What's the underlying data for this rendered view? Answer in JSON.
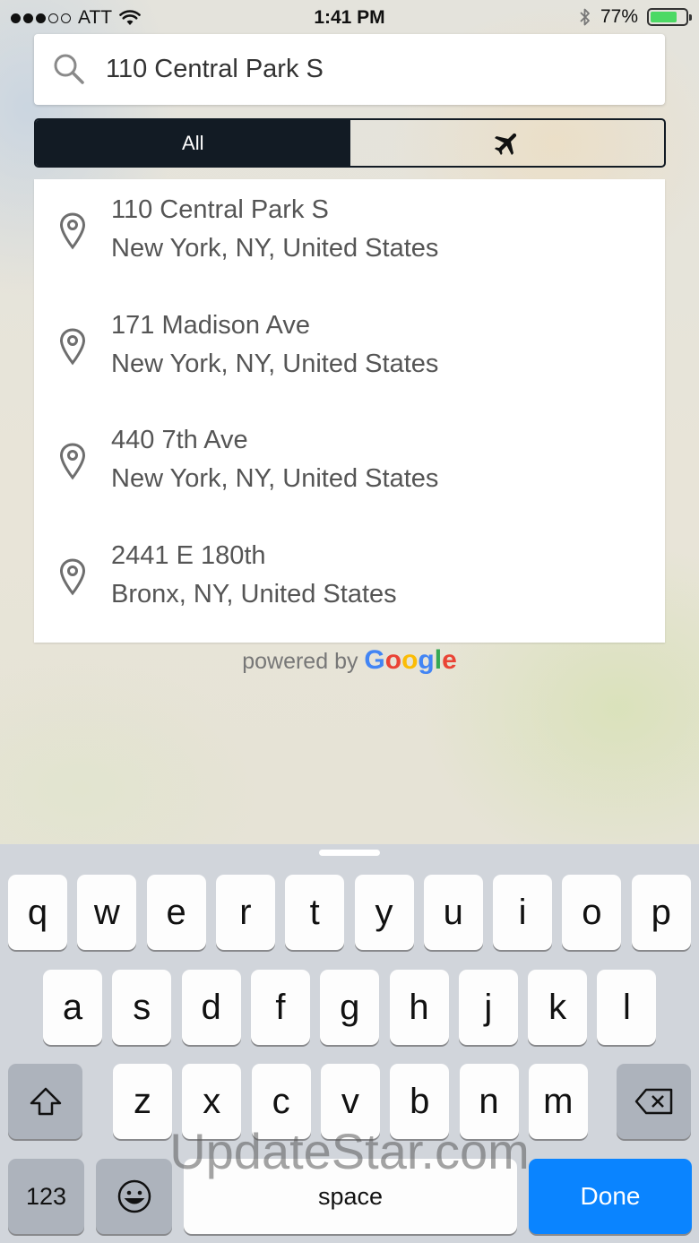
{
  "status_bar": {
    "carrier": "ATT",
    "time": "1:41 PM",
    "battery_percent": "77%",
    "battery_level": 0.77,
    "signal_dots_filled": 3,
    "signal_dots_total": 5
  },
  "search": {
    "value": "110 Central Park S"
  },
  "filter_tabs": {
    "all_label": "All",
    "airport_icon": "airplane-icon",
    "selected": "all"
  },
  "results": [
    {
      "street": "110 Central Park S",
      "locality": "New York, NY, United States"
    },
    {
      "street": "171 Madison Ave",
      "locality": "New York, NY, United States"
    },
    {
      "street": "440 7th Ave",
      "locality": "New York, NY, United States"
    },
    {
      "street": "2441 E 180th",
      "locality": "Bronx, NY, United States"
    }
  ],
  "attribution": {
    "prefix": "powered by",
    "brand_letters": [
      "G",
      "o",
      "o",
      "g",
      "l",
      "e"
    ],
    "brand_colors": [
      "#4285F4",
      "#EA4335",
      "#FBBC05",
      "#4285F4",
      "#34A853",
      "#EA4335"
    ]
  },
  "keyboard": {
    "row1": [
      "q",
      "w",
      "e",
      "r",
      "t",
      "y",
      "u",
      "i",
      "o",
      "p"
    ],
    "row2": [
      "a",
      "s",
      "d",
      "f",
      "g",
      "h",
      "j",
      "k",
      "l"
    ],
    "row3": [
      "z",
      "x",
      "c",
      "v",
      "b",
      "n",
      "m"
    ],
    "numbers_label": "123",
    "space_label": "space",
    "done_label": "Done",
    "done_color": "#0A84FF"
  },
  "watermark": "UpdateStar.com"
}
